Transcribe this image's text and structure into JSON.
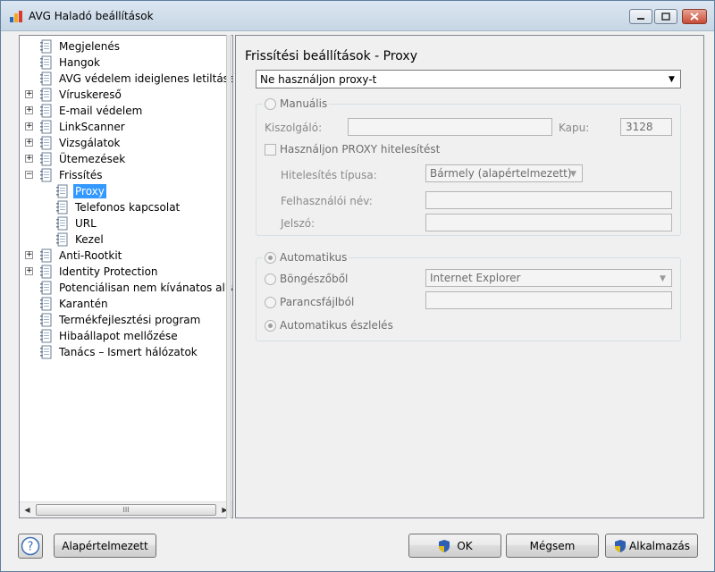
{
  "window": {
    "title": "AVG Haladó beállítások",
    "controls": {
      "minimize": "minimize-icon",
      "maximize": "maximize-icon",
      "close": "close-icon"
    }
  },
  "tree": {
    "items": [
      {
        "label": "Megjelenés",
        "expandable": false
      },
      {
        "label": "Hangok",
        "expandable": false
      },
      {
        "label": "AVG védelem ideiglenes letiltása",
        "expandable": false
      },
      {
        "label": "Víruskereső",
        "expandable": true,
        "expanded": false
      },
      {
        "label": "E-mail védelem",
        "expandable": true,
        "expanded": false
      },
      {
        "label": "LinkScanner",
        "expandable": true,
        "expanded": false
      },
      {
        "label": "Vizsgálatok",
        "expandable": true,
        "expanded": false
      },
      {
        "label": "Ütemezések",
        "expandable": true,
        "expanded": false
      },
      {
        "label": "Frissítés",
        "expandable": true,
        "expanded": true
      },
      {
        "label": "Proxy",
        "child": true,
        "selected": true
      },
      {
        "label": "Telefonos kapcsolat",
        "child": true
      },
      {
        "label": "URL",
        "child": true
      },
      {
        "label": "Kezel",
        "child": true
      },
      {
        "label": "Anti-Rootkit",
        "expandable": true,
        "expanded": false
      },
      {
        "label": "Identity Protection",
        "expandable": true,
        "expanded": false
      },
      {
        "label": "Potenciálisan nem kívánatos alkalm",
        "expandable": false
      },
      {
        "label": "Karantén",
        "expandable": false
      },
      {
        "label": "Termékfejlesztési program",
        "expandable": false
      },
      {
        "label": "Hibaállapot mellőzése",
        "expandable": false
      },
      {
        "label": "Tanács – Ismert hálózatok",
        "expandable": false
      }
    ],
    "scroll_thumb_grip": "III"
  },
  "settings": {
    "title": "Frissítési beállítások - Proxy",
    "proxy_mode": "Ne használjon proxy-t",
    "manual": {
      "label": "Manuális",
      "server_label": "Kiszolgáló:",
      "server_value": "",
      "port_label": "Kapu:",
      "port_value": "3128",
      "auth_checkbox": "Használjon PROXY hitelesítést",
      "auth_type_label": "Hitelesítés típusa:",
      "auth_type_value": "Bármely (alapértelmezett)",
      "username_label": "Felhasználói név:",
      "username_value": "",
      "password_label": "Jelszó:",
      "password_value": ""
    },
    "automatic": {
      "label": "Automatikus",
      "browser_label": "Böngészőből",
      "browser_value": "Internet Explorer",
      "script_label": "Parancsfájlból",
      "script_value": "",
      "detect_label": "Automatikus észlelés",
      "selected": "detect"
    }
  },
  "footer": {
    "help": "?",
    "default_button": "Alapértelmezett",
    "ok_button": "OK",
    "cancel_button": "Mégsem",
    "apply_button": "Alkalmazás"
  },
  "colors": {
    "selection": "#3399ff",
    "avg_logo_orange": "#f47b20",
    "shield_blue": "#2f5fb3",
    "shield_yellow": "#f5c400"
  }
}
